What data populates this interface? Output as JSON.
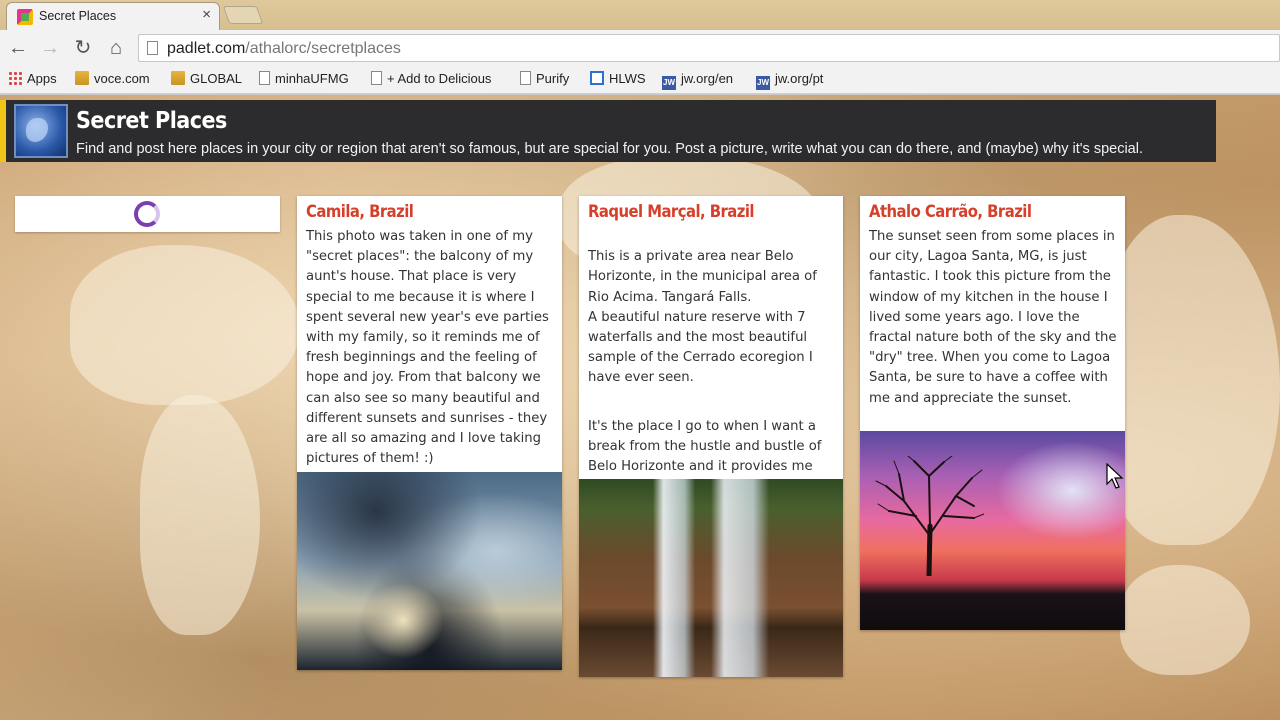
{
  "browser": {
    "tab": {
      "title": "Secret Places",
      "close": "×"
    },
    "nav": {
      "back": "←",
      "forward": "→",
      "reload": "↻",
      "home": "⌂"
    },
    "url": {
      "host": "padlet.com",
      "path": "/athalorc/secretplaces"
    },
    "bookmarks": [
      {
        "label": "Apps",
        "icon": "apps-grid-icon"
      },
      {
        "label": "voce.com",
        "icon": "folder-icon"
      },
      {
        "label": "GLOBAL",
        "icon": "folder-icon"
      },
      {
        "label": "minhaUFMG",
        "icon": "page-icon"
      },
      {
        "label": "+ Add to Delicious",
        "icon": "page-icon"
      },
      {
        "label": "Purify",
        "icon": "page-icon"
      },
      {
        "label": "HLWS",
        "icon": "hlws-icon"
      },
      {
        "label": "jw.org/en",
        "icon": "jw-icon"
      },
      {
        "label": "jw.org/pt",
        "icon": "jw-icon"
      }
    ]
  },
  "wall": {
    "title": "Secret Places",
    "description": "Find and post here places in your city or region that aren't so famous, but are special for you. Post a picture, write what you can do there, and (maybe) why it's special."
  },
  "posts": [
    {
      "author": "Camila, Brazil",
      "paragraphs": [
        "This photo was taken in one of my \"secret places\": the balcony of my aunt's house. That place is very special to me because it is where I spent several new year's eve parties with my family, so it reminds me of fresh beginnings and the feeling of hope and joy. From that balcony we can also see so many beautiful and different sunsets and sunrises - they are all so amazing and I love taking pictures of them! :)"
      ],
      "image": "cloudy-sky-photo"
    },
    {
      "author": "Raquel Marçal, Brazil",
      "paragraphs": [
        "This is a private area near Belo Horizonte, in the municipal area of Rio Acima. Tangará Falls.\nA beautiful nature reserve with 7 waterfalls and the most beautiful sample of the Cerrado ecoregion I have ever seen.",
        "It's the place I go to when I want a break from the hustle and bustle of Belo Horizonte and it provides me with peace, quiet and a lot of nature sounds."
      ],
      "image": "waterfall-photo"
    },
    {
      "author": "Athalo Carrão, Brazil",
      "paragraphs": [
        "The sunset seen from some places in our city, Lagoa Santa, MG, is just fantastic. I took this picture from the window of my kitchen in the house I lived some years ago. I love the fractal nature both of the sky and the \"dry\" tree. When you come to Lagoa Santa, be sure to have a coffee with me and appreciate the sunset."
      ],
      "image": "sunset-tree-photo"
    }
  ],
  "colors": {
    "accent": "#f0c419",
    "author": "#d6402b",
    "header_bg": "#2c2c2e",
    "spinner": "#7b3fb4"
  }
}
